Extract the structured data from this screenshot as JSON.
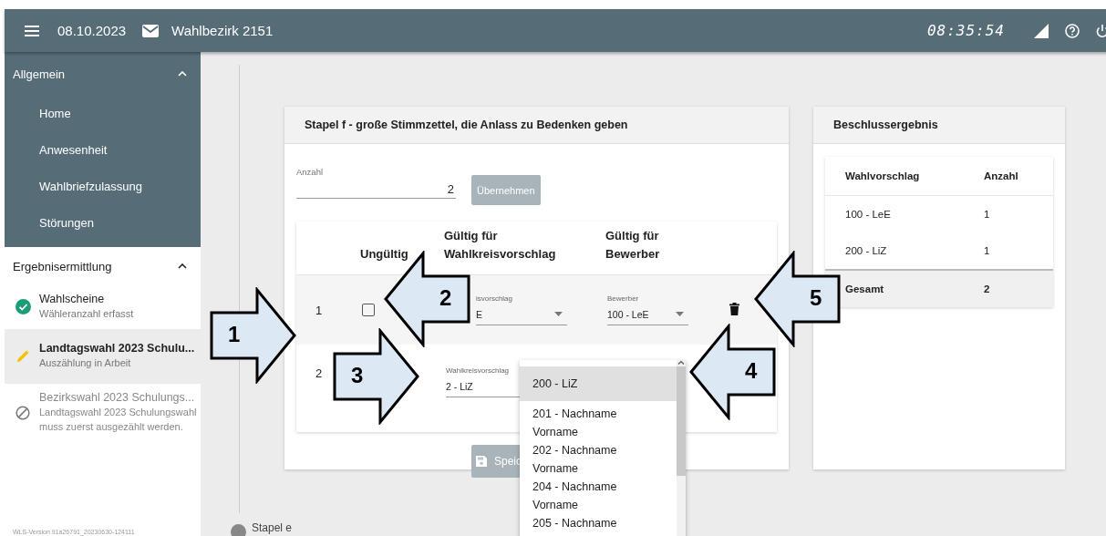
{
  "header": {
    "date": "08.10.2023",
    "district": "Wahlbezirk 2151",
    "time": "08:35:54"
  },
  "sidebar": {
    "groups": [
      {
        "title": "Allgemein",
        "expanded": true,
        "items": [
          {
            "label": "Home"
          },
          {
            "label": "Anwesenheit"
          },
          {
            "label": "Wahlbriefzulassung"
          },
          {
            "label": "Störungen"
          }
        ]
      },
      {
        "title": "Ergebnisermittlung",
        "expanded": true,
        "steps": [
          {
            "title": "Wahlscheine",
            "subtitle": "Wähleranzahl erfasst",
            "kind": "done",
            "selected": false
          },
          {
            "title": "Landtagswahl 2023 Schulu...",
            "subtitle": "Auszählung in Arbeit",
            "kind": "in_progress",
            "selected": true
          },
          {
            "title": "Bezirkswahl 2023 Schulungs...",
            "subtitle": "Landtagswahl 2023 Schulungswahl muss zuerst ausgezählt werden.",
            "kind": "blocked",
            "selected": false
          }
        ]
      }
    ],
    "version": "WLS-Version 91a26791_20230630-124111"
  },
  "stack_card": {
    "title": "Stapel f - große Stimmzettel, die Anlass zu Bedenken geben",
    "count_field": {
      "label": "Anzahl",
      "value": "2"
    },
    "apply_button": {
      "label": "Übernehmen",
      "disabled": true
    },
    "columns": [
      "Ungültig",
      "Gültig für Wahlkreisvorschlag",
      "Gültig für Bewerber"
    ],
    "rows": [
      {
        "index": "1",
        "invalid": false,
        "proposal_field": {
          "label": "isvorschlag",
          "value": "E"
        },
        "candidate_field": {
          "label": "Bewerber",
          "value": "100 - LeE"
        }
      },
      {
        "index": "2",
        "proposal_field": {
          "label": "Wahlkreisvorschlag",
          "value": "2 - LiZ"
        }
      }
    ],
    "save_button": {
      "label": "Speic",
      "disabled": true
    },
    "dropdown": {
      "options": [
        {
          "label": "200 - LiZ",
          "selected": true
        },
        {
          "label": "201 - Nachname Vorname",
          "selected": false
        },
        {
          "label": "202 - Nachname Vorname",
          "selected": false
        },
        {
          "label": "204 - Nachname Vorname",
          "selected": false
        },
        {
          "label": "205 - Nachname",
          "selected": false
        }
      ]
    }
  },
  "result_card": {
    "title": "Beschlussergebnis",
    "columns": [
      "Wahlvorschlag",
      "Anzahl"
    ],
    "rows": [
      {
        "proposal": "100 - LeE",
        "count": "1"
      },
      {
        "proposal": "200 - LiZ",
        "count": "1"
      }
    ],
    "total": {
      "label": "Gesamt",
      "count": "2"
    }
  },
  "next_step": {
    "label": "Stapel e"
  },
  "callouts": [
    {
      "label": "1",
      "kind": "right"
    },
    {
      "label": "2",
      "kind": "left"
    },
    {
      "label": "3",
      "kind": "right"
    },
    {
      "label": "4",
      "kind": "left"
    },
    {
      "label": "5",
      "kind": "left"
    }
  ]
}
